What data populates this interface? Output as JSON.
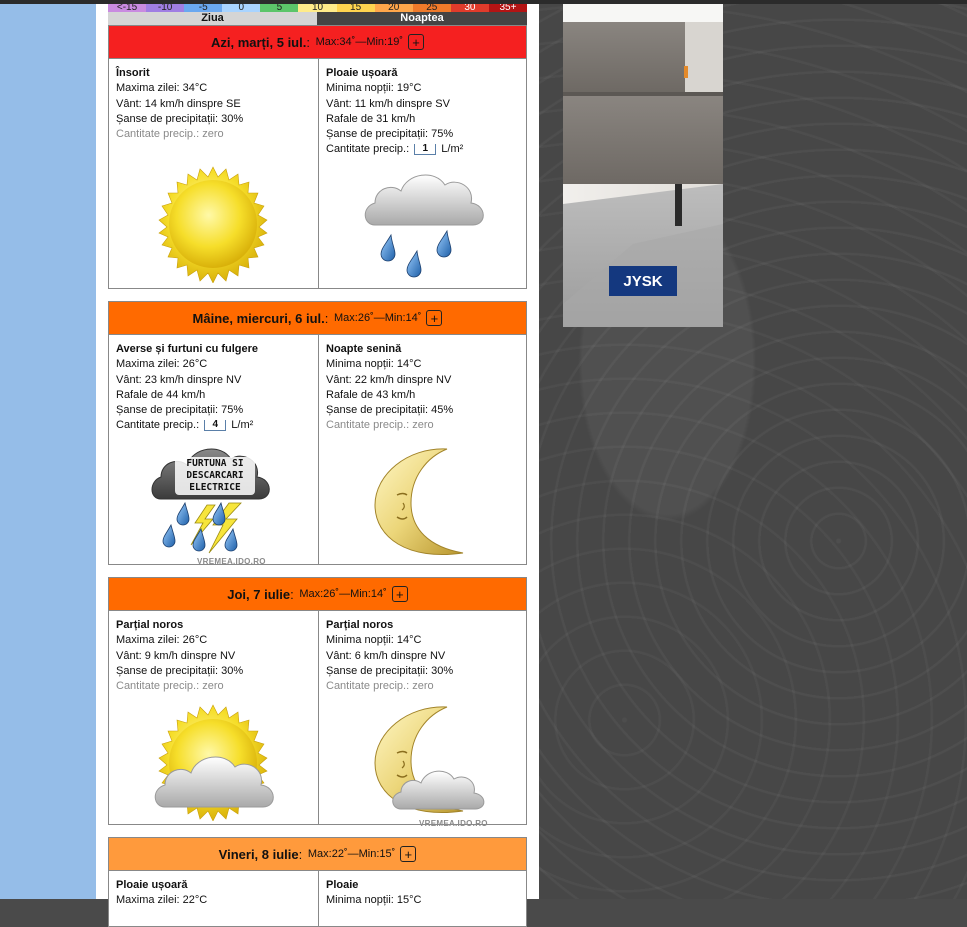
{
  "scale": {
    "labels": [
      "<-15",
      "-10",
      "-5",
      "0",
      "5",
      "10",
      "15",
      "20",
      "25",
      "30",
      "35+"
    ],
    "colors": [
      "#c98be0",
      "#a07ee3",
      "#6aa8f0",
      "#a9d4ff",
      "#5cc56a",
      "#ffec8a",
      "#ffd44f",
      "#ffa64a",
      "#f07a2a",
      "#e03b2b",
      "#b31414"
    ]
  },
  "header": {
    "day_label": "Ziua",
    "night_label": "Noaptea"
  },
  "days": [
    {
      "title": "Azi, marți, 5 iul.",
      "max": "Max:34˚",
      "sep": " — ",
      "min": "Min:19˚",
      "plus": "+",
      "header_color": "#f52020",
      "day": {
        "title": "Însorit",
        "lines": [
          "Maxima zilei: 34°C",
          "Vânt: 14 km/h dinspre SE",
          "Șanse de precipitații: 30%"
        ],
        "precip": "Cantitate precip.: zero",
        "icon": "sun-icon"
      },
      "night": {
        "title": "Ploaie ușoară",
        "lines": [
          "Minima nopții: 19°C",
          "Vânt: 11 km/h dinspre SV",
          "Rafale de 31 km/h",
          "Șanse de precipitații: 75%"
        ],
        "precip_label": "Cantitate precip.:",
        "precip_value": "1",
        "precip_unit": "L/m²",
        "icon": "rain-cloud-icon"
      }
    },
    {
      "title": "Mâine, miercuri, 6 iul.",
      "max": "Max:26˚",
      "sep": " — ",
      "min": "Min:14˚",
      "plus": "+",
      "header_color": "#ff6a00",
      "day": {
        "title": "Averse și furtuni cu fulgere",
        "lines": [
          "Maxima zilei: 26°C",
          "Vânt: 23 km/h dinspre NV",
          "Rafale de 44 km/h",
          "Șanse de precipitații: 75%"
        ],
        "precip_label": "Cantitate precip.:",
        "precip_value": "4",
        "precip_unit": "L/m²",
        "icon": "thunderstorm-icon",
        "icon_text": [
          "FURTUNA SI",
          "DESCARCARI",
          "ELECTRICE"
        ],
        "watermark": "VREMEA.IDO.RO"
      },
      "night": {
        "title": "Noapte senină",
        "lines": [
          "Minima nopții: 14°C",
          "Vânt: 22 km/h dinspre NV",
          "Rafale de 43 km/h",
          "Șanse de precipitații: 45%"
        ],
        "precip": "Cantitate precip.: zero",
        "icon": "moon-icon"
      }
    },
    {
      "title": "Joi, 7 iulie",
      "max": "Max:26˚",
      "sep": " — ",
      "min": "Min:14˚",
      "plus": "+",
      "header_color": "#ff6a00",
      "day": {
        "title": "Parțial noros",
        "lines": [
          "Maxima zilei: 26°C",
          "Vânt: 9 km/h dinspre NV",
          "Șanse de precipitații: 30%"
        ],
        "precip": "Cantitate precip.: zero",
        "icon": "sun-cloud-icon"
      },
      "night": {
        "title": "Parțial noros",
        "lines": [
          "Minima nopții: 14°C",
          "Vânt: 6 km/h dinspre NV",
          "Șanse de precipitații: 30%"
        ],
        "precip": "Cantitate precip.: zero",
        "icon": "moon-cloud-icon",
        "watermark": "VREMEA.IDO.RO"
      }
    },
    {
      "title": "Vineri, 8 iulie",
      "max": "Max:22˚",
      "sep": " — ",
      "min": "Min:15˚",
      "plus": "+",
      "header_color": "#ff9a3c",
      "day": {
        "title": "Ploaie ușoară",
        "lines": [
          "Maxima zilei: 22°C"
        ]
      },
      "night": {
        "title": "Ploaie",
        "lines": [
          "Minima nopții: 15°C"
        ]
      }
    }
  ],
  "ad": {
    "brand": "JYSK"
  }
}
